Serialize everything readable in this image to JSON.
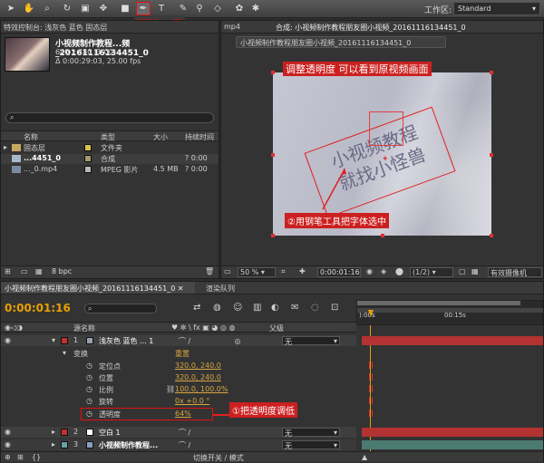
{
  "toolbar": {
    "workspace_label": "工作区:",
    "workspace_value": "Standard"
  },
  "callouts": {
    "pen_tool": "钢笔工具",
    "adjust_opacity": "调整透明度 可以看到原视频画面",
    "select_text": "②用钢笔工具把字体选中",
    "lower_opacity": "①把透明度调低"
  },
  "project": {
    "effects_tab": "特效控制台: 浅灰色 蓝色 固态层",
    "item_name": "小视频制作教程...频_20161116134451_0",
    "item_details": "640 x 480 (1.00)",
    "item_duration": "Δ 0:00:29:03, 25.00 fps",
    "search_placeholder": "",
    "columns": {
      "name": "名称",
      "type": "类型",
      "size": "大小",
      "duration": "持续时间"
    },
    "rows": [
      {
        "name": "固态层",
        "type": "文件夹",
        "size": "",
        "dur": "",
        "color": "#d8c24a"
      },
      {
        "name": "...4451_0",
        "type": "合成",
        "size": "",
        "dur": "? 0:00",
        "color": "#a89a6a"
      },
      {
        "name": "..._0.mp4",
        "type": "MPEG 影片",
        "size": "4.5 MB",
        "dur": "? 0:00",
        "color": "#b8b8b8"
      }
    ],
    "bpc": "8 bpc"
  },
  "composition": {
    "tab_left": "mp4",
    "tab": "合成: 小视频制作教程朋友圈小视频_20161116134451_0",
    "subtab": "小视频制作教程朋友圈小视频_20161116134451_0",
    "watermark_line1": "小视频教程",
    "watermark_line2": "就找小怪兽",
    "zoom": "50 %",
    "timecode": "0:00:01:16",
    "resolution": "(1/2)",
    "camera": "有效摄像机"
  },
  "timeline": {
    "tab": "小视频制作教程朋友圈小视频_20161116134451_0",
    "render_tab": "渲染队列",
    "timecode": "0:00:01:16",
    "ruler": {
      "start": "):00s",
      "mid": "00:15s"
    },
    "headers": {
      "source": "源名称",
      "parent": "父级"
    },
    "layers": [
      {
        "num": "1",
        "name": "浅灰色 蓝色 ... 1",
        "parent": "无",
        "color": "#c03030"
      },
      {
        "num": "2",
        "name": "空白 1",
        "parent": "无",
        "color": "#c03030"
      },
      {
        "num": "3",
        "name": "小视频制作教程...",
        "parent": "无",
        "color": "#6aa0a0"
      }
    ],
    "transform": {
      "label": "变换",
      "reset": "重置"
    },
    "props": [
      {
        "name": "定位点",
        "value": "320.0, 240.0"
      },
      {
        "name": "位置",
        "value": "320.0, 240.0"
      },
      {
        "name": "比例",
        "value": "100.0, 100.0%"
      },
      {
        "name": "旋转",
        "value": "0x +0.0 °"
      },
      {
        "name": "透明度",
        "value": "64%"
      }
    ],
    "footer": "切换开关 / 模式"
  }
}
